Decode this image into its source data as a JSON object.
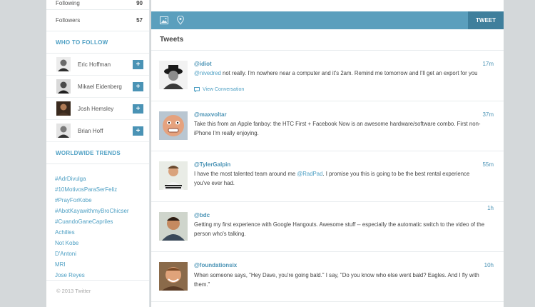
{
  "sidebar": {
    "stats": [
      {
        "label": "Following",
        "value": "90"
      },
      {
        "label": "Followers",
        "value": "57"
      }
    ],
    "who_to_follow_title": "WHO TO FOLLOW",
    "who_to_follow": [
      {
        "name": "Eric Hoffman",
        "button": "+"
      },
      {
        "name": "Mikael Eidenberg",
        "button": "+"
      },
      {
        "name": "Josh Hemsley",
        "button": "+"
      },
      {
        "name": "Brian Hoff",
        "button": "+"
      }
    ],
    "trends_title": "WORLDWIDE TRENDS",
    "trends": [
      "#AdrDivulga",
      "#10MotivosParaSerFeliz",
      "#PrayForKobe",
      "#AbotKayawithmyBroChicser",
      "#CuandoGaneCapriles",
      "Achilles",
      "Not Kobe",
      "D'Antoni",
      "MRI",
      "Jose Reyes"
    ],
    "copyright": "© 2013 Twitter"
  },
  "composer": {
    "photo_icon": "photo-icon",
    "location_icon": "location-pin-icon",
    "tweet_button": "TWEET"
  },
  "feed": {
    "title": "Tweets",
    "tweets": [
      {
        "handle": "@idiot",
        "time": "17m",
        "mention": "@nivedred",
        "text": " not really. I'm nowhere near a computer and it's 2am. Remind me tomorrow and I'll get an export for you",
        "conversation": "View Conversation"
      },
      {
        "handle": "@maxvoltar",
        "time": "37m",
        "pre": "Take this from an Apple fanboy: the HTC First + Facebook Now is an awesome hardware/software combo. First non-iPhone I'm really enjoying."
      },
      {
        "handle": "@TylerGalpin",
        "time": "55m",
        "pre": "I have the most talented team around me ",
        "mention": "@RadPad",
        "post": ". I promise you this is going to be the best rental experience you've ever had."
      },
      {
        "handle": "@bdc",
        "time": "1h",
        "pre": "Getting my first experience with Google Hangouts. Awesome stuff -- especially the automatic switch to the video of the person who's talking."
      },
      {
        "handle": "@foundationsix",
        "time": "10h",
        "pre": "When someone says, \"Hey Dave, you're going bald.\" I say, \"Do you know who else went bald? Eagles. And I fly with them.\""
      }
    ]
  },
  "colors": {
    "accent": "#4a93b5",
    "composer_bg": "#5b9fbd",
    "tweet_button_bg": "#3f7f9c",
    "page_bg": "#d4d8da"
  }
}
